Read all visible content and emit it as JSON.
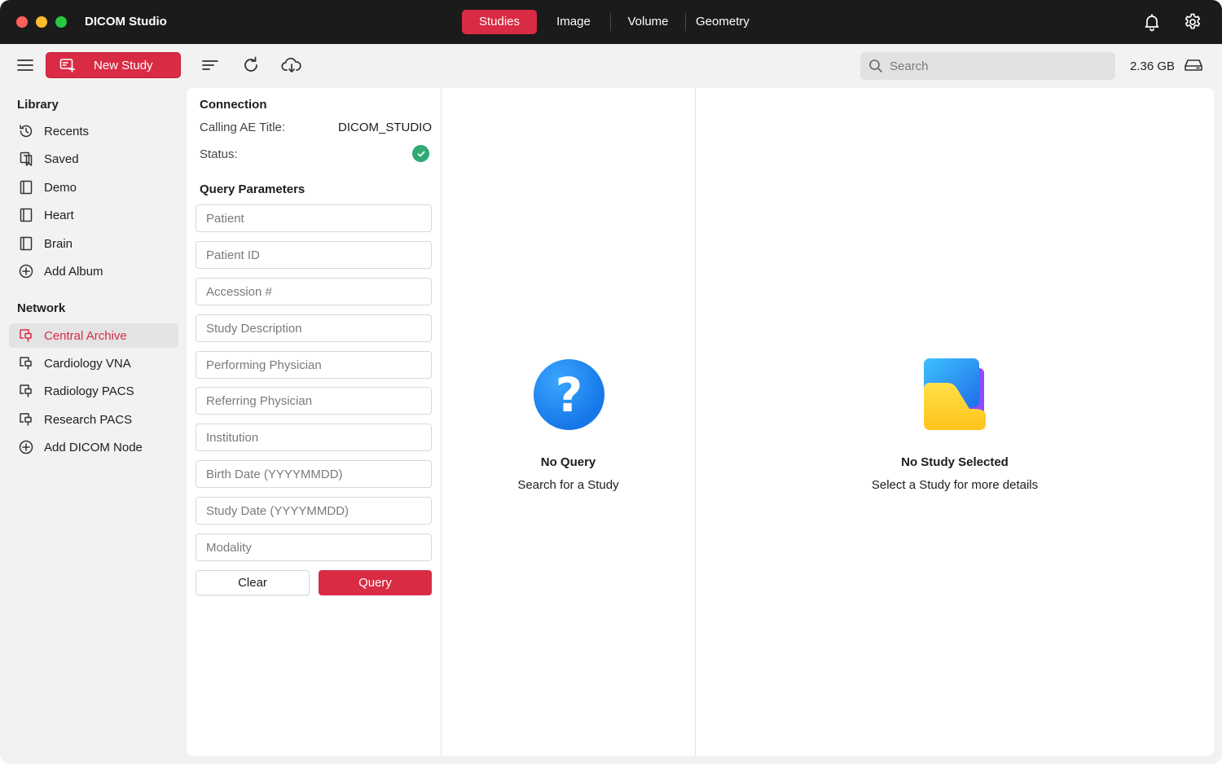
{
  "app": {
    "title": "DICOM Studio"
  },
  "nav_tabs": [
    {
      "label": "Studies",
      "active": true
    },
    {
      "label": "Image",
      "active": false
    },
    {
      "label": "Volume",
      "active": false
    },
    {
      "label": "Geometry",
      "active": false
    }
  ],
  "toolbar": {
    "new_study_label": "New Study",
    "search_placeholder": "Search",
    "storage_used": "2.36 GB"
  },
  "sidebar": {
    "library_heading": "Library",
    "library_items": [
      {
        "label": "Recents",
        "icon": "clock-history-icon"
      },
      {
        "label": "Saved",
        "icon": "bookmark-icon"
      },
      {
        "label": "Demo",
        "icon": "album-icon"
      },
      {
        "label": "Heart",
        "icon": "album-icon"
      },
      {
        "label": "Brain",
        "icon": "album-icon"
      },
      {
        "label": "Add Album",
        "icon": "plus-circle-icon"
      }
    ],
    "network_heading": "Network",
    "network_items": [
      {
        "label": "Central Archive",
        "icon": "network-node-icon",
        "active": true
      },
      {
        "label": "Cardiology VNA",
        "icon": "network-node-icon",
        "active": false
      },
      {
        "label": "Radiology PACS",
        "icon": "network-node-icon",
        "active": false
      },
      {
        "label": "Research PACS",
        "icon": "network-node-icon",
        "active": false
      },
      {
        "label": "Add DICOM Node",
        "icon": "plus-circle-icon",
        "active": false
      }
    ]
  },
  "connection": {
    "heading": "Connection",
    "calling_ae_label": "Calling AE Title:",
    "calling_ae_value": "DICOM_STUDIO",
    "status_label": "Status:",
    "status_icon": "check-circle-icon"
  },
  "query": {
    "heading": "Query Parameters",
    "fields": [
      {
        "placeholder": "Patient",
        "value": ""
      },
      {
        "placeholder": "Patient ID",
        "value": ""
      },
      {
        "placeholder": "Accession #",
        "value": ""
      },
      {
        "placeholder": "Study Description",
        "value": ""
      },
      {
        "placeholder": "Performing Physician",
        "value": ""
      },
      {
        "placeholder": "Referring Physician",
        "value": ""
      },
      {
        "placeholder": "Institution",
        "value": ""
      },
      {
        "placeholder": "Birth Date (YYYYMMDD)",
        "value": ""
      },
      {
        "placeholder": "Study Date (YYYYMMDD)",
        "value": ""
      },
      {
        "placeholder": "Modality",
        "value": ""
      }
    ],
    "clear_label": "Clear",
    "query_label": "Query"
  },
  "results_empty": {
    "title": "No Query",
    "subtitle": "Search for a Study",
    "icon": "question-circle-icon"
  },
  "detail_empty": {
    "title": "No Study Selected",
    "subtitle": "Select a Study for more details",
    "icon": "folder-icon"
  },
  "colors": {
    "accent": "#d92b43",
    "titlebar": "#1b1b1b",
    "status_ok": "#2eaa73"
  }
}
